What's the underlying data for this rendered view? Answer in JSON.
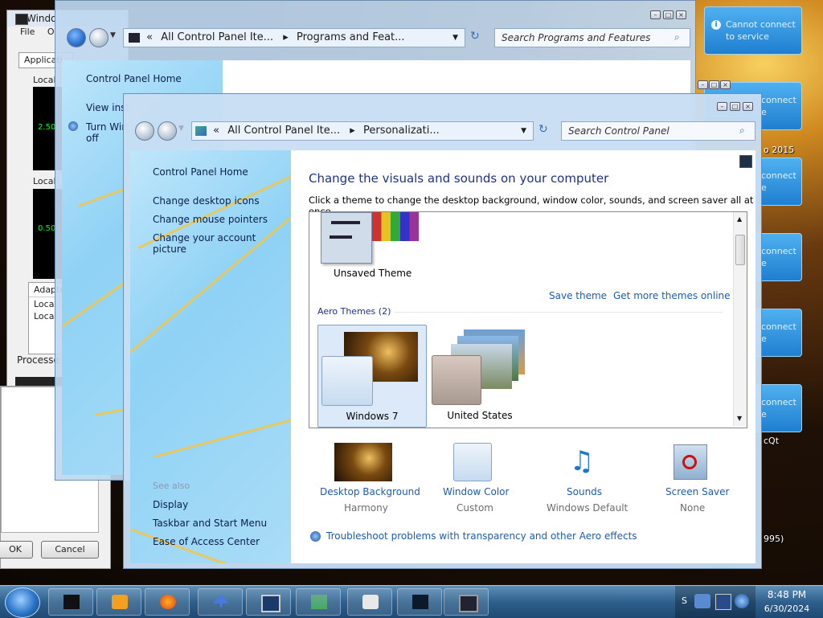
{
  "taskmgr": {
    "title": "Windo",
    "menu": [
      "File",
      "O"
    ],
    "tab": "Applicati",
    "local1": "Local",
    "graph1_label": "2.50",
    "local2": "Local",
    "graph2_label": "0.50",
    "adapter": "Adapte",
    "local3": "Local",
    "local4": "Local",
    "processes": "Processe"
  },
  "dialog": {
    "ok_label": "OK",
    "cancel_label": "Cancel"
  },
  "notifications": {
    "text_line1": "Cannot connect",
    "text_line2": "to service",
    "partial": "connect",
    "partial2": "e"
  },
  "desktop_labels": {
    "year": "o 2015",
    "qt": "cQt",
    "num": "995)"
  },
  "programs_window": {
    "breadcrumb_root": "All Control Panel Ite...",
    "breadcrumb_current": "Programs and Feat...",
    "search_placeholder": "Search Programs and Features",
    "side_home": "Control Panel Home",
    "side_view": "View inst",
    "side_turn": "Turn Win",
    "side_turn2": "off"
  },
  "personalization": {
    "breadcrumb_root": "All Control Panel Ite...",
    "breadcrumb_current": "Personalizati...",
    "search_placeholder": "Search Control Panel",
    "side_home": "Control Panel Home",
    "side_links": [
      "Change desktop icons",
      "Change mouse pointers",
      "Change your account picture"
    ],
    "see_also": "See also",
    "see_also_links": [
      "Display",
      "Taskbar and Start Menu",
      "Ease of Access Center"
    ],
    "heading": "Change the visuals and sounds on your computer",
    "description": "Click a theme to change the desktop background, window color, sounds, and screen saver all at once.",
    "unsaved_theme": "Unsaved Theme",
    "save_theme": "Save theme",
    "more_themes": "Get more themes online",
    "aero_header": "Aero Themes (2)",
    "themes": [
      "Windows 7",
      "United States"
    ],
    "bottom": [
      {
        "label": "Desktop Background",
        "value": "Harmony"
      },
      {
        "label": "Window Color",
        "value": "Custom"
      },
      {
        "label": "Sounds",
        "value": "Windows Default"
      },
      {
        "label": "Screen Saver",
        "value": "None"
      }
    ],
    "troubleshoot": "Troubleshoot problems with transparency and other Aero effects"
  },
  "clock": {
    "time": "8:48 PM",
    "date": "6/30/2024"
  },
  "colors": {
    "link": "#1e5ab4",
    "heading": "#1e3287",
    "taskbar": "#2f5f8c"
  }
}
